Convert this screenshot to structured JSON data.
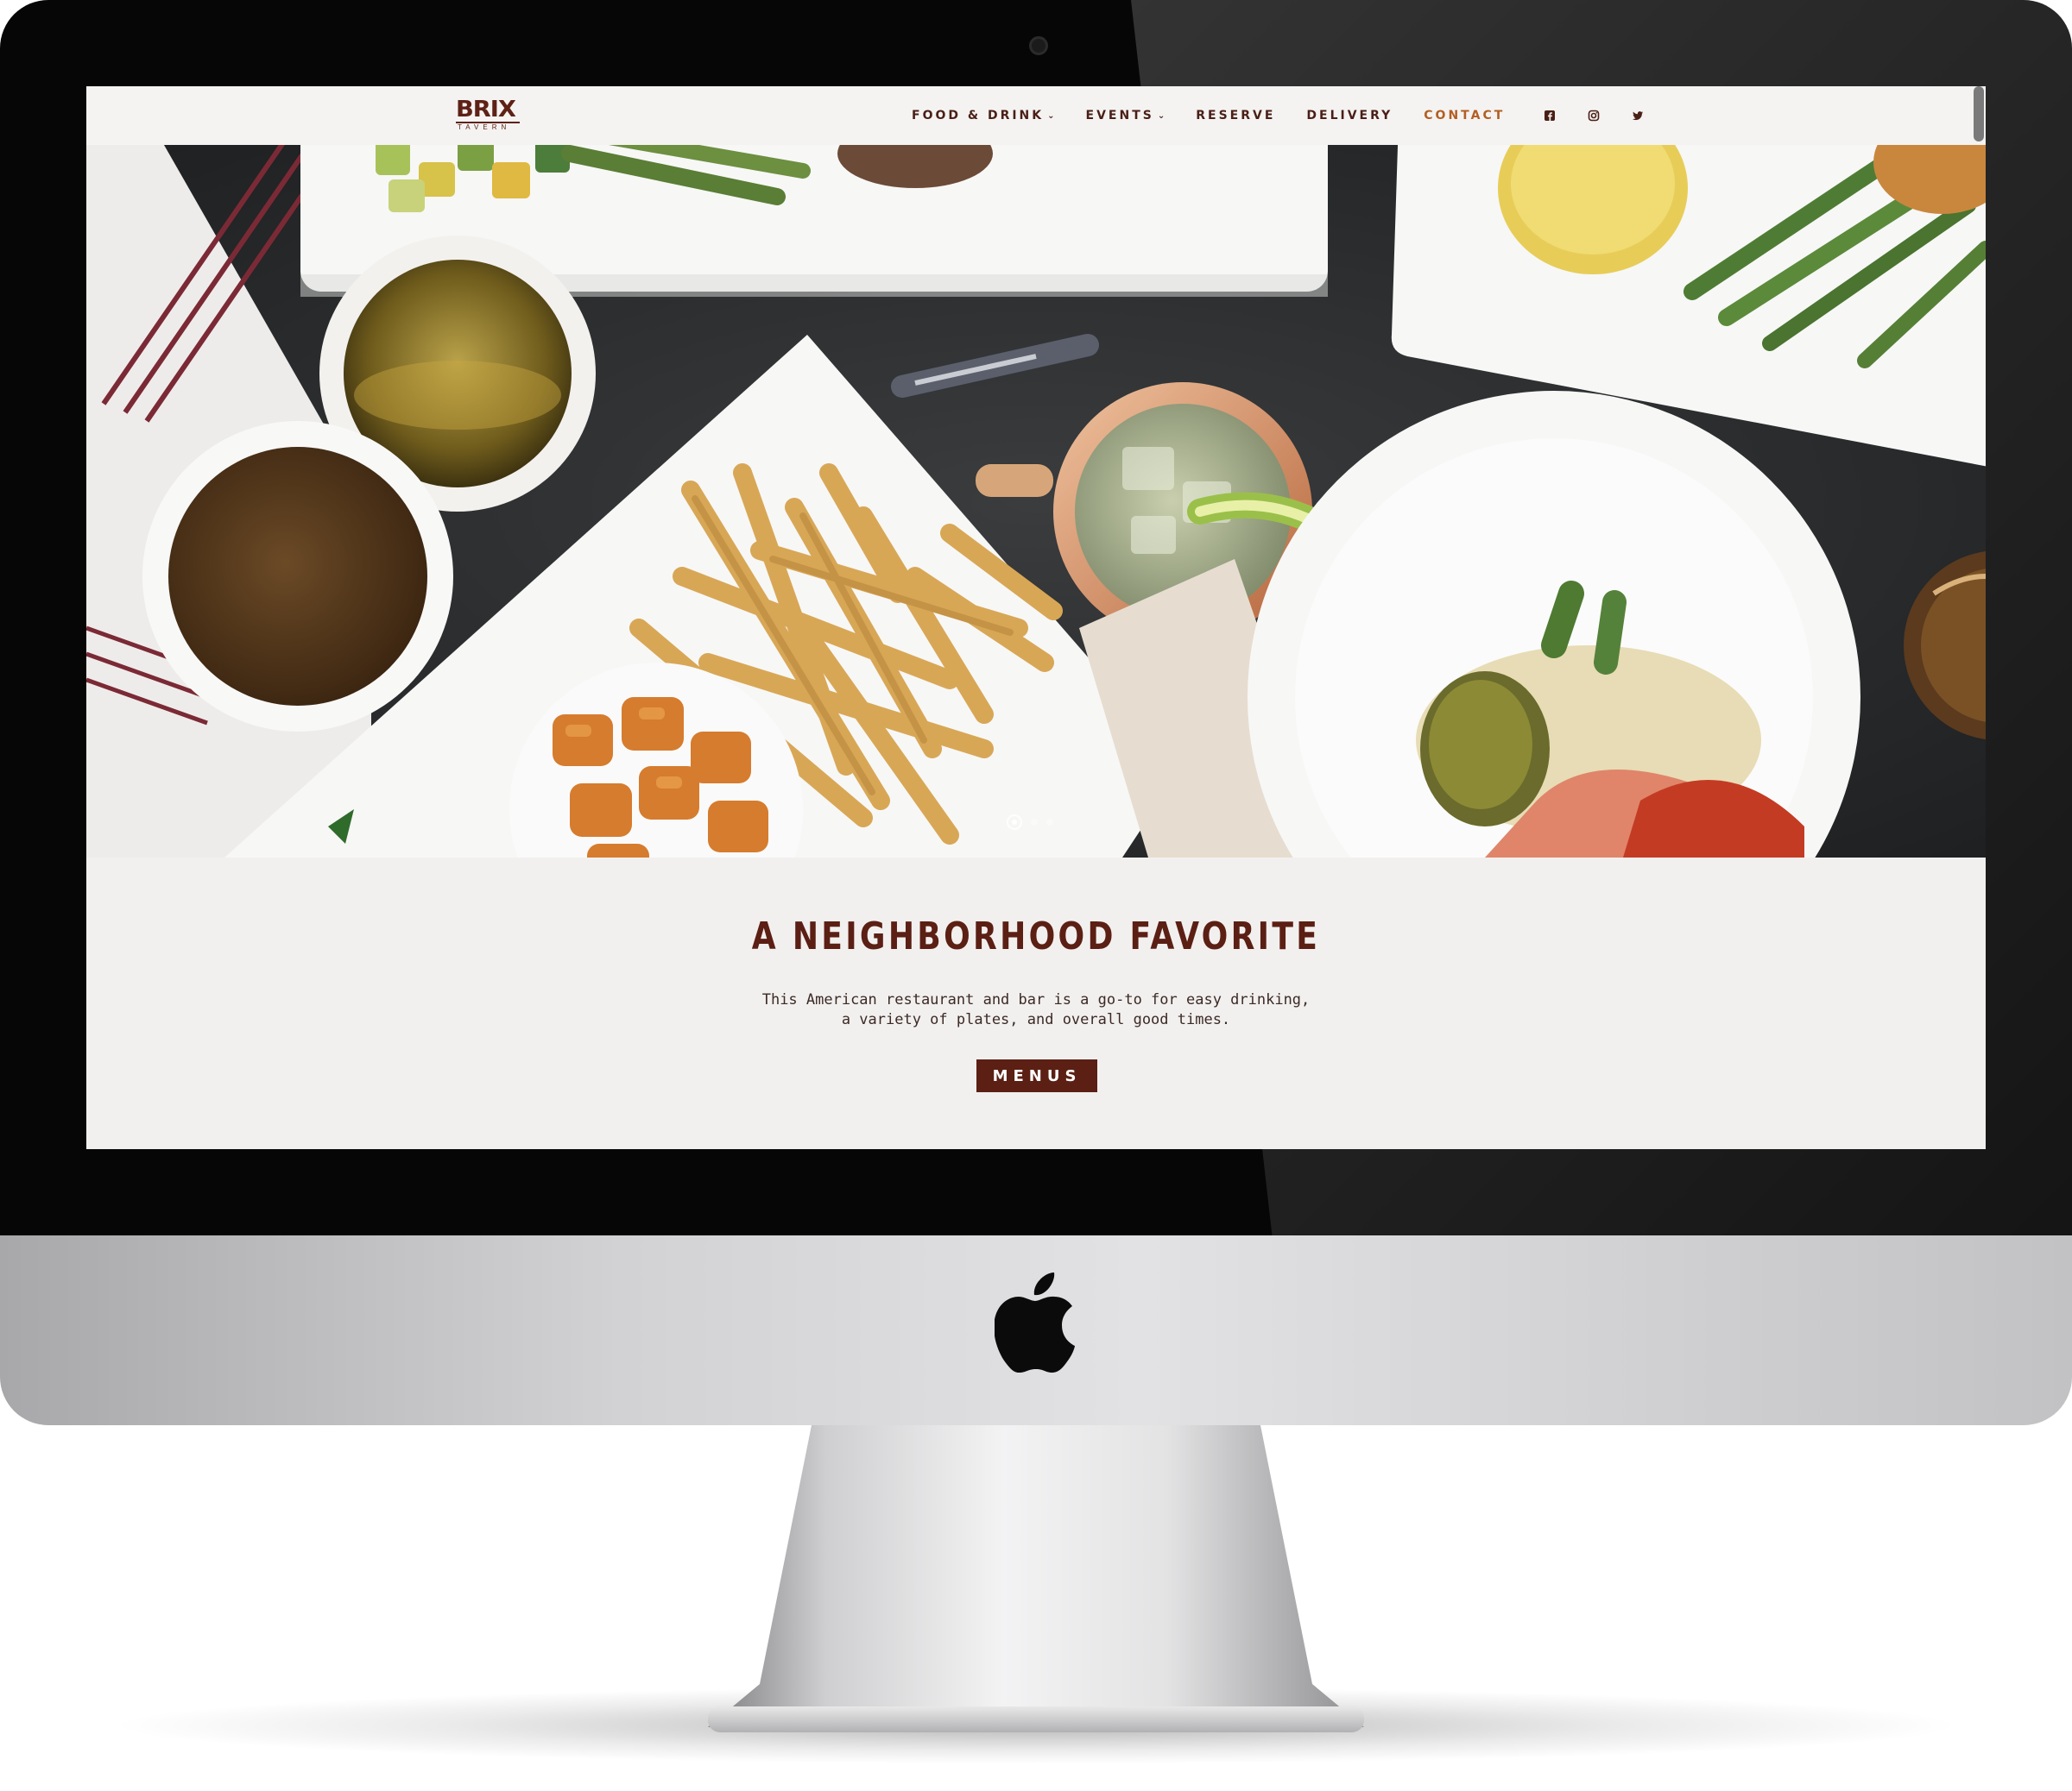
{
  "logo": {
    "main": "BRIX",
    "sub": "TAVERN"
  },
  "nav": {
    "items": [
      {
        "label": "FOOD & DRINK",
        "caret": "⌄"
      },
      {
        "label": "EVENTS",
        "caret": "⌄"
      },
      {
        "label": "RESERVE"
      },
      {
        "label": "DELIVERY"
      },
      {
        "label": "CONTACT"
      }
    ],
    "active_item": "CONTACT",
    "social_icons": [
      "facebook-icon",
      "instagram-icon",
      "twitter-icon"
    ]
  },
  "hero": {
    "image_description_icons": [
      "hero-food-photo"
    ],
    "slider": {
      "current": 1
    }
  },
  "intro": {
    "title": "A NEIGHBORHOOD FAVORITE",
    "text_line1": "This American restaurant and bar is a go-to for easy drinking,",
    "text_line2": "a variety of plates, and overall good times.",
    "button_label": "MENUS"
  },
  "colors": {
    "brand": "#5b1f14",
    "active_nav": "#b35f22",
    "page_bg": "#f2f0ef"
  }
}
